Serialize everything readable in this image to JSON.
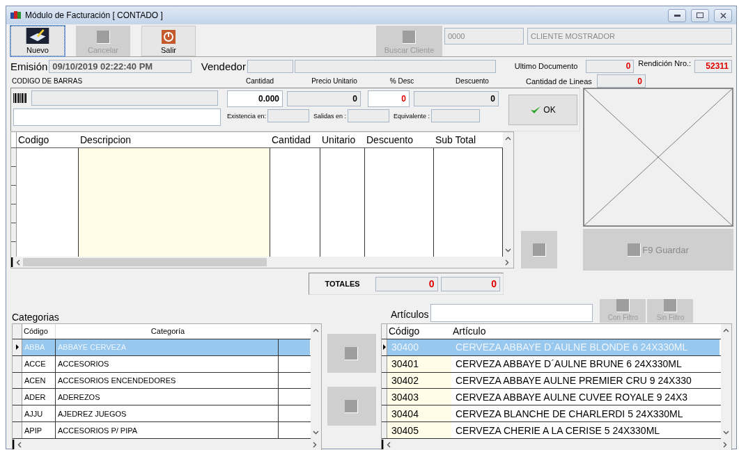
{
  "window": {
    "title": "Módulo de Facturación [ CONTADO ]"
  },
  "toolbar": [
    {
      "kind": "new",
      "label": "Nuevo",
      "disabled": false
    },
    {
      "kind": "blank",
      "label": "Cancelar",
      "disabled": true
    },
    {
      "kind": "exit",
      "label": "Salir",
      "disabled": false
    }
  ],
  "client": {
    "search_button": {
      "label": "Buscar Cliente",
      "disabled": true
    },
    "code": "0000",
    "name": "CLIENTE MOSTRADOR"
  },
  "header": {
    "emision_label": "Emisión",
    "emision_value": "09/10/2019 02:22:40 PM",
    "vendedor_label": "Vendedor",
    "ultimo_documento_label": "Ultimo Documento",
    "ultimo_documento_value": "0",
    "rendicion_label": "Rendición Nro.:",
    "rendicion_value": "52311",
    "cantidad_lineas_label": "Cantidad de Lineas",
    "cantidad_lineas_value": "0"
  },
  "entry": {
    "barcode_label": "CODIGO DE BARRAS",
    "fields": [
      {
        "label": "Cantidad",
        "value": "0.000",
        "editable": true,
        "color": "#000000"
      },
      {
        "label": "Precio Unitario",
        "value": "0",
        "editable": false,
        "color": "#000000"
      },
      {
        "label": "% Desc",
        "value": "0",
        "editable": true,
        "color": "#e00000"
      },
      {
        "label": "Descuento",
        "value": "0",
        "editable": false,
        "color": "#000000"
      }
    ],
    "sub_labels": [
      "Existencia en:",
      "Salidas en :",
      "Equivalente :"
    ],
    "ok_button": "OK"
  },
  "detail_table": {
    "columns": [
      "Codigo",
      "Descripcion",
      "Cantidad",
      "Unitario",
      "Descuento",
      "Sub Total"
    ]
  },
  "totals": {
    "label": "TOTALES",
    "values": [
      "0",
      "0"
    ]
  },
  "save_button": {
    "label": "F9 Guardar",
    "disabled": true
  },
  "categorias": {
    "title": "Categorias",
    "columns": [
      "Código",
      "Categoría"
    ],
    "rows": [
      {
        "code": "ABBA",
        "name": "ABBAYE CERVEZA",
        "selected": true
      },
      {
        "code": "ACCE",
        "name": "ACCESORIOS",
        "selected": false
      },
      {
        "code": "ACEN",
        "name": "ACCESORIOS ENCENDEDORES",
        "selected": false
      },
      {
        "code": "ADER",
        "name": "ADEREZOS",
        "selected": false
      },
      {
        "code": "AJJU",
        "name": "AJEDREZ JUEGOS",
        "selected": false
      },
      {
        "code": "APIP",
        "name": "ACCESORIOS P/ PIPA",
        "selected": false
      }
    ]
  },
  "articulos": {
    "label": "Artículos",
    "filter_buttons": [
      {
        "label": "Con Filtro",
        "disabled": true
      },
      {
        "label": "Sin Filtro",
        "disabled": true
      }
    ],
    "columns": [
      "Código",
      "Artículo"
    ],
    "rows": [
      {
        "code": "30400",
        "name": "CERVEZA ABBAYE D´AULNE BLONDE 6 24X330ML",
        "selected": true
      },
      {
        "code": "30401",
        "name": "CERVEZA ABBAYE D´AULNE BRUNE 6 24X330ML",
        "selected": false
      },
      {
        "code": "30402",
        "name": "CERVEZA ABBAYE AULNE PREMIER CRU 9 24X330",
        "selected": false
      },
      {
        "code": "30403",
        "name": "CERVEZA ABBAYE AULNE CUVEE ROYALE 9 24X3",
        "selected": false
      },
      {
        "code": "30404",
        "name": "CERVEZA BLANCHE DE CHARLERDI 5 24X330ML",
        "selected": false
      },
      {
        "code": "30405",
        "name": "CERVEZA CHERIE A LA CERISE 5 24X330ML",
        "selected": false
      }
    ]
  }
}
